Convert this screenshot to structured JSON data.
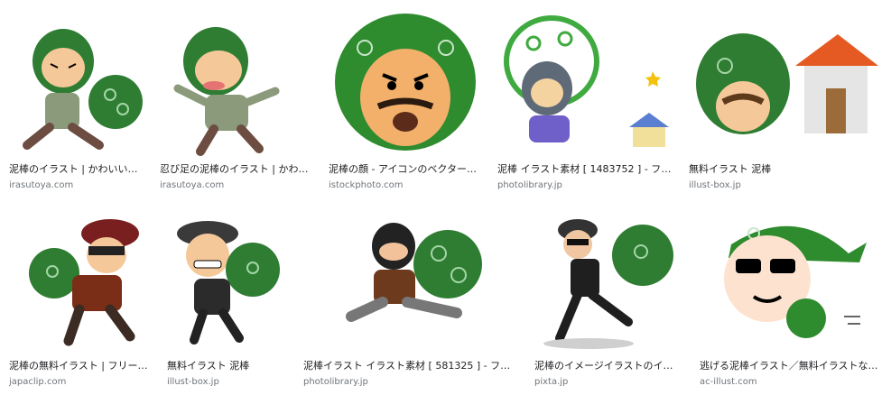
{
  "results": [
    {
      "title": "泥棒のイラスト | かわいい…",
      "source": "irasutoya.com",
      "thumb_icon": "thief-running-with-sack-icon",
      "scarf_color": "#2e7d32",
      "bg": "#ffffff"
    },
    {
      "title": "忍び足の泥棒のイラスト | かわ…",
      "source": "irasutoya.com",
      "thumb_icon": "thief-sneaking-icon",
      "scarf_color": "#2e7d32",
      "bg": "#ffffff"
    },
    {
      "title": "泥棒の顔 - アイコンのベクター…",
      "source": "istockphoto.com",
      "thumb_icon": "thief-face-icon",
      "scarf_color": "#2e8b2e",
      "bg": "#ffffff"
    },
    {
      "title": "泥棒 イラスト素材 [ 1483752 ] - フォ…",
      "source": "photolibrary.jp",
      "thumb_icon": "thief-with-house-icon",
      "scarf_color": "#3faa3f",
      "bg": "#ffffff"
    },
    {
      "title": "無料イラスト 泥棒",
      "source": "illust-box.jp",
      "thumb_icon": "thief-near-house-icon",
      "scarf_color": "#2e7d32",
      "bg": "#ffffff"
    },
    {
      "title": "泥棒の無料イラスト | フリー…",
      "source": "japaclip.com",
      "thumb_icon": "thief-cap-sack-icon",
      "scarf_color": "#2e7d32",
      "bg": "#ffffff"
    },
    {
      "title": "無料イラスト 泥棒",
      "source": "illust-box.jp",
      "thumb_icon": "thief-grinning-icon",
      "scarf_color": "#2e7d32",
      "bg": "#ffffff"
    },
    {
      "title": "泥棒イラスト イラスト素材 [ 581325 ] - フォ…",
      "source": "photolibrary.jp",
      "thumb_icon": "thief-masked-running-icon",
      "scarf_color": "#2e7d32",
      "bg": "#ffffff"
    },
    {
      "title": "泥棒のイメージイラストのイ…",
      "source": "pixta.jp",
      "thumb_icon": "thief-black-suit-icon",
      "scarf_color": "#2e7d32",
      "bg": "#ffffff"
    },
    {
      "title": "逃げる泥棒イラスト／無料イラストな…",
      "source": "ac-illust.com",
      "thumb_icon": "thief-sunglasses-icon",
      "scarf_color": "#2e8b2e",
      "bg": "#ffffff"
    }
  ]
}
